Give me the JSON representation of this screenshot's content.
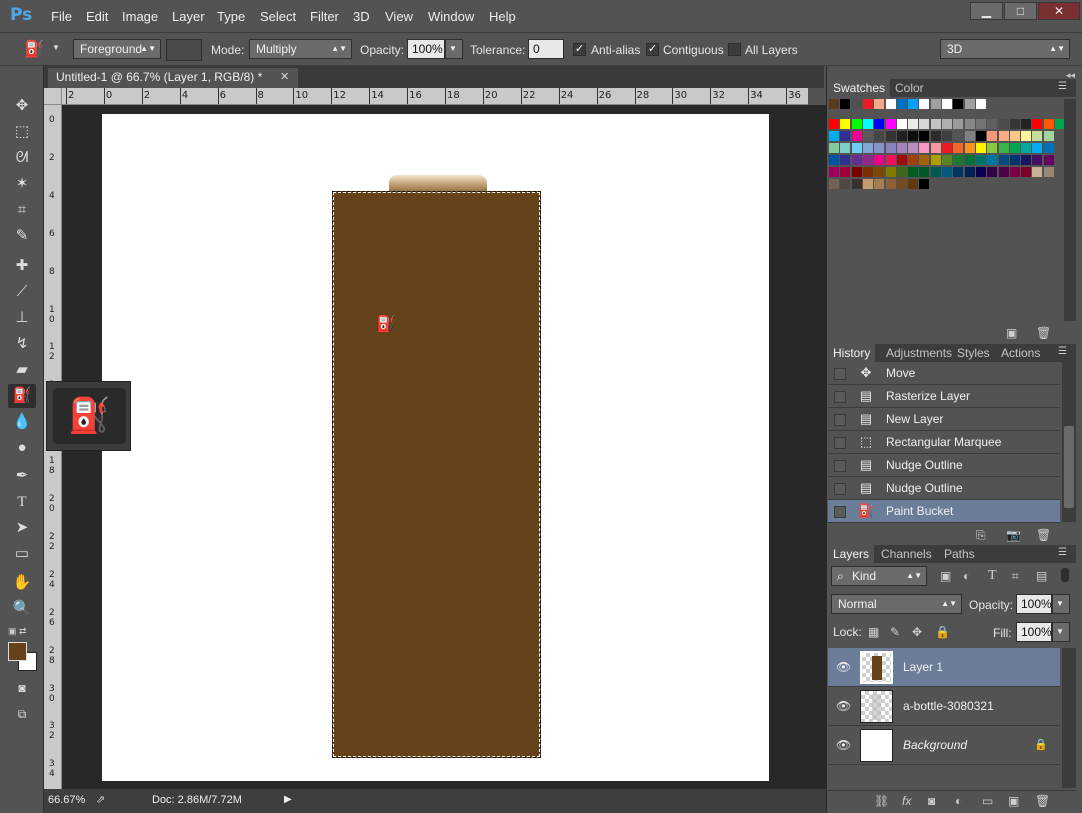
{
  "menubar": {
    "logo": "Ps",
    "items": [
      "File",
      "Edit",
      "Image",
      "Layer",
      "Type",
      "Select",
      "Filter",
      "3D",
      "View",
      "Window",
      "Help"
    ],
    "window_buttons": [
      "▁",
      "□",
      "✕"
    ]
  },
  "options": {
    "tool_icon": "paint-bucket-icon",
    "fill_source": "Foreground",
    "mode_label": "Mode:",
    "mode_value": "Multiply",
    "opacity_label": "Opacity:",
    "opacity_value": "100%",
    "tolerance_label": "Tolerance:",
    "tolerance_value": "0",
    "antialias_label": "Anti-alias",
    "antialias_checked": true,
    "contiguous_label": "Contiguous",
    "contiguous_checked": true,
    "alllayers_label": "All Layers",
    "alllayers_checked": false,
    "workspace": "3D"
  },
  "document": {
    "tab_title": "Untitled-1 @ 66.7% (Layer 1, RGB/8) *",
    "fill_color": "#65421a"
  },
  "rulers": {
    "h_ticks": [
      "2",
      "0",
      "2",
      "4",
      "6",
      "8",
      "10",
      "12",
      "14",
      "16",
      "18",
      "20",
      "22",
      "24",
      "26",
      "28",
      "30",
      "32",
      "34",
      "36"
    ],
    "v_ticks": [
      "0",
      "2",
      "4",
      "6",
      "8",
      "1 0",
      "1 2",
      "1 4",
      "1 6",
      "1 8",
      "2 0",
      "2 2",
      "2 4",
      "2 6",
      "2 8",
      "3 0",
      "3 2",
      "3 4"
    ]
  },
  "status": {
    "zoom": "66.67%",
    "doc": "Doc: 2.86M/7.72M"
  },
  "toolbar": {
    "tools": [
      "move",
      "marquee",
      "lasso",
      "magic-wand",
      "crop",
      "eyedropper",
      "healing",
      "brush",
      "stamp",
      "history-brush",
      "eraser",
      "paint-bucket",
      "blur",
      "dodge",
      "pen",
      "type",
      "path-select",
      "shape",
      "hand",
      "zoom"
    ],
    "foreground": "#65421a",
    "background": "#ffffff"
  },
  "swatches_panel": {
    "tabs": [
      "Swatches",
      "Color"
    ],
    "rows": [
      [
        "#5b3a1a",
        "#000000",
        "#505050",
        "#ed1c24",
        "#f4a98a",
        "#ffffff",
        "#0070c0",
        "#00a0ff",
        "#ffffff",
        "#a0a0a0",
        "#ffffff",
        "#000000",
        "#a0a0a0",
        "#ffffff"
      ],
      [
        "#ff0000",
        "#ffff00",
        "#00ff00",
        "#00ffff",
        "#0000ff",
        "#ff00ff",
        "#ffffff",
        "#ebebeb",
        "#d7d7d7",
        "#c3c3c3",
        "#afafaf",
        "#9b9b9b",
        "#878787",
        "#737373",
        "#5f5f5f",
        "#4b4b4b",
        "#373737",
        "#232323",
        "#ff0000",
        "#ff5a00",
        "#00a651"
      ],
      [
        "#00aeef",
        "#2e3192",
        "#ec008c",
        "#595959",
        "#464646",
        "#333333",
        "#202020",
        "#0d0d0d",
        "#000000",
        "#2a2a2a",
        "#3f3f3f",
        "#545454",
        "#7f7f7f",
        "#000000",
        "#f7977a",
        "#f9ad81",
        "#fdc68a",
        "#fff79a",
        "#c4df9b",
        "#a3d39c"
      ],
      [
        "#82ca9d",
        "#7bcdc8",
        "#6ecff6",
        "#7ea7d8",
        "#8493ca",
        "#8882be",
        "#a187be",
        "#bc8dbf",
        "#f49ac2",
        "#f6989d",
        "#ed1c24",
        "#f26522",
        "#f7941d",
        "#fff200",
        "#8dc63f",
        "#39b54a",
        "#00a651",
        "#00a99d",
        "#00aeef",
        "#0072bc"
      ],
      [
        "#0054a6",
        "#2e3192",
        "#662d91",
        "#92278f",
        "#ec008c",
        "#ed145b",
        "#9e0b0f",
        "#a0410d",
        "#a36209",
        "#aba000",
        "#598527",
        "#1a7b30",
        "#007236",
        "#00746b",
        "#0076a3",
        "#004b80",
        "#003471",
        "#1b1464",
        "#440e62",
        "#630460"
      ],
      [
        "#9e005d",
        "#9e0039",
        "#790000",
        "#7b2e00",
        "#7d4900",
        "#827b00",
        "#406618",
        "#005e20",
        "#005826",
        "#005952",
        "#005b7f",
        "#003663",
        "#002157",
        "#0d004c",
        "#32004b",
        "#4b0049",
        "#7b0046",
        "#7a0026",
        "#c7b299",
        "#998675"
      ],
      [
        "#736357",
        "#534741",
        "#37302d",
        "#c69c6d",
        "#a67c52",
        "#8c6239",
        "#754c24",
        "#603913",
        "#000000"
      ]
    ]
  },
  "history_panel": {
    "tabs": [
      "History",
      "Adjustments",
      "Styles",
      "Actions"
    ],
    "items": [
      {
        "label": "Move",
        "icon": "move-tool-icon"
      },
      {
        "label": "Rasterize Layer",
        "icon": "document-icon"
      },
      {
        "label": "New Layer",
        "icon": "document-icon"
      },
      {
        "label": "Rectangular Marquee",
        "icon": "marquee-icon"
      },
      {
        "label": "Nudge Outline",
        "icon": "document-icon"
      },
      {
        "label": "Nudge Outline",
        "icon": "document-icon"
      },
      {
        "label": "Paint Bucket",
        "icon": "paint-bucket-icon"
      }
    ]
  },
  "layers_panel": {
    "tabs": [
      "Layers",
      "Channels",
      "Paths"
    ],
    "filter_label": "Kind",
    "blend_mode": "Normal",
    "opacity_label": "Opacity:",
    "opacity_value": "100%",
    "lock_label": "Lock:",
    "fill_label": "Fill:",
    "fill_value": "100%",
    "layers": [
      {
        "name": "Layer 1",
        "active": true
      },
      {
        "name": "a-bottle-3080321",
        "active": false
      },
      {
        "name": "Background",
        "active": false,
        "locked": true
      }
    ]
  }
}
